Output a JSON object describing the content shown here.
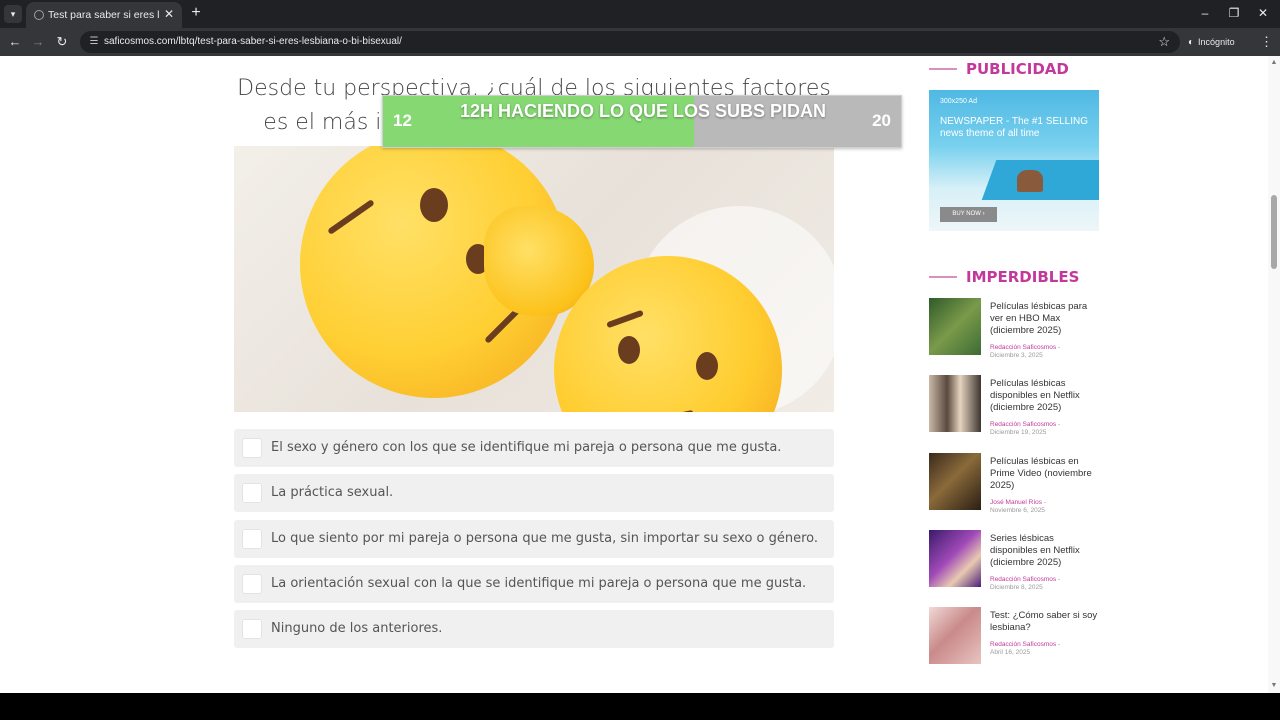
{
  "browser": {
    "tab_title": "Test para saber si eres lesbiana",
    "tab_close": "✕",
    "new_tab": "+",
    "url": "saficosmos.com/lbtq/test-para-saber-si-eres-lesbiana-o-bi-bisexual/",
    "incognito_label": "Incógnito",
    "icons": {
      "tab_list": "▾",
      "back": "←",
      "forward": "→",
      "reload": "↻",
      "site_info": "☰",
      "bookmark_star": "☆",
      "incognito": "◐",
      "menu": "⋮",
      "minimize": "–",
      "restore": "❐",
      "close": "✕"
    }
  },
  "quiz": {
    "question": "Desde tu perspectiva, ¿cuál de los siguientes factores es el más importante para tu orientación sexual?",
    "options": [
      "El sexo y género con los que se identifique mi pareja o persona que me gusta.",
      "La práctica sexual.",
      "Lo que siento por mi pareja o persona que me gusta, sin importar su sexo o género.",
      "La orientación sexual con la que se identifique mi pareja o persona que me gusta.",
      "Ninguno de los anteriores."
    ]
  },
  "overlay": {
    "left_number": "12",
    "right_number": "20",
    "label": "12H HACIENDO LO QUE LOS SUBS PIDAN",
    "progress": 0.6,
    "fill_color": "#86d873",
    "track_color": "#b9b9b9"
  },
  "sidebar": {
    "publicidad_title": "PUBLICIDAD",
    "ad": {
      "size_label": "300x250 Ad",
      "line1": "NEWSPAPER - The #1 SELLING",
      "line2": "news theme of all time",
      "button": "BUY NOW ›"
    },
    "imperdibles_title": "IMPERDIBLES",
    "articles": [
      {
        "title": "Películas lésbicas para ver en HBO Max (diciembre 2025)",
        "author": "Redacción Saficosmos",
        "sep": "-",
        "date": "Diciembre 3, 2025"
      },
      {
        "title": "Películas lésbicas disponibles en Netflix (diciembre 2025)",
        "author": "Redacción Saficosmos",
        "sep": "-",
        "date": "Diciembre 19, 2025"
      },
      {
        "title": "Películas lésbicas en Prime Video (noviembre 2025)",
        "author": "José Manuel Ríos",
        "sep": "-",
        "date": "Noviembre 6, 2025"
      },
      {
        "title": "Series lésbicas disponibles en Netflix (diciembre 2025)",
        "author": "Redacción Saficosmos",
        "sep": "-",
        "date": "Diciembre 8, 2025"
      },
      {
        "title": "Test: ¿Cómo saber si soy lesbiana?",
        "author": "Redacción Saficosmos",
        "sep": "-",
        "date": "Abril 16, 2025"
      }
    ]
  },
  "colors": {
    "accent_pink": "#c2399a",
    "option_bg": "#f0f0f0"
  }
}
